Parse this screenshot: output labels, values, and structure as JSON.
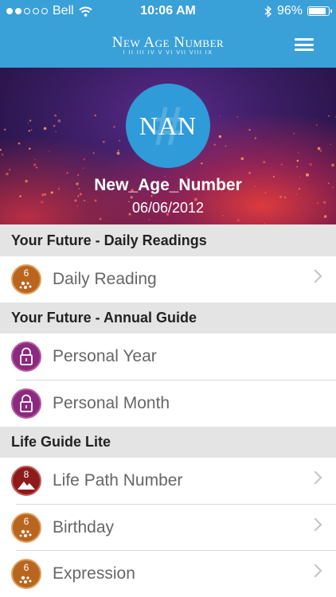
{
  "status_bar": {
    "carrier": "Bell",
    "time": "10:06 AM",
    "battery": "96%",
    "battery_level": 0.96
  },
  "header": {
    "brand_name": "New Age Number",
    "brand_sub": "I II III IV V VI VII VIII IX",
    "menu_icon": "hamburger-menu-icon"
  },
  "profile": {
    "logo": "NAN",
    "username": "New_Age_Number",
    "date": "06/06/2012"
  },
  "sections": [
    {
      "title": "Your Future - Daily Readings",
      "items": [
        {
          "label": "Daily Reading",
          "icon": "number-six-icon",
          "icon_number": "6",
          "chevron": true
        }
      ]
    },
    {
      "title": "Your Future - Annual Guide",
      "items": [
        {
          "label": "Personal Year",
          "icon": "lock-icon",
          "chevron": false
        },
        {
          "label": "Personal Month",
          "icon": "lock-icon",
          "chevron": false
        }
      ]
    },
    {
      "title": "Life Guide Lite",
      "items": [
        {
          "label": "Life Path Number",
          "icon": "number-eight-icon",
          "icon_number": "8",
          "chevron": true
        },
        {
          "label": "Birthday",
          "icon": "number-six-icon",
          "icon_number": "6",
          "chevron": true
        },
        {
          "label": "Expression",
          "icon": "number-six-icon",
          "icon_number": "6",
          "chevron": true
        }
      ]
    }
  ],
  "colors": {
    "header_blue": "#3aa0d8",
    "section_bg": "#e4e4e4",
    "six_orange": "#b8661f",
    "eight_red": "#8d1b1b",
    "lock_purple": "#8a2a7f"
  }
}
